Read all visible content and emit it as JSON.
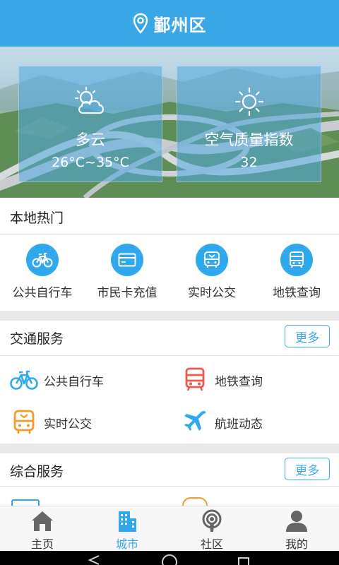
{
  "header": {
    "location": "鄞州区",
    "icon": "location-pin-icon",
    "color": "#3aa7e6"
  },
  "weather": {
    "left": {
      "icon": "partly-cloudy-icon",
      "condition": "多云",
      "temperature": "26°C~35°C"
    },
    "right": {
      "icon": "sun-icon",
      "label": "空气质量指数",
      "value": "32"
    }
  },
  "hot": {
    "title": "本地热门",
    "items": [
      {
        "label": "公共自行车",
        "icon": "bicycle-icon"
      },
      {
        "label": "市民卡充值",
        "icon": "card-icon"
      },
      {
        "label": "实时公交",
        "icon": "bus-icon"
      },
      {
        "label": "地铁查询",
        "icon": "metro-icon"
      }
    ]
  },
  "traffic": {
    "title": "交通服务",
    "more": "更多",
    "items": [
      {
        "label": "公共自行车",
        "icon": "bicycle-icon",
        "color": "#2fa8ee"
      },
      {
        "label": "地铁查询",
        "icon": "metro-icon",
        "color": "#f05a4e"
      },
      {
        "label": "实时公交",
        "icon": "bus-icon",
        "color": "#f39a2b"
      },
      {
        "label": "航班动态",
        "icon": "airplane-icon",
        "color": "#2fa8ee"
      }
    ]
  },
  "general": {
    "title": "综合服务",
    "more": "更多"
  },
  "tabs": [
    {
      "label": "主页",
      "icon": "home-icon",
      "active": false
    },
    {
      "label": "城市",
      "icon": "city-icon",
      "active": true
    },
    {
      "label": "社区",
      "icon": "podcast-icon",
      "active": false
    },
    {
      "label": "我的",
      "icon": "user-icon",
      "active": false
    }
  ],
  "system_nav": {
    "back": "back-icon",
    "home": "home-circle-icon",
    "recent": "recent-apps-icon"
  }
}
